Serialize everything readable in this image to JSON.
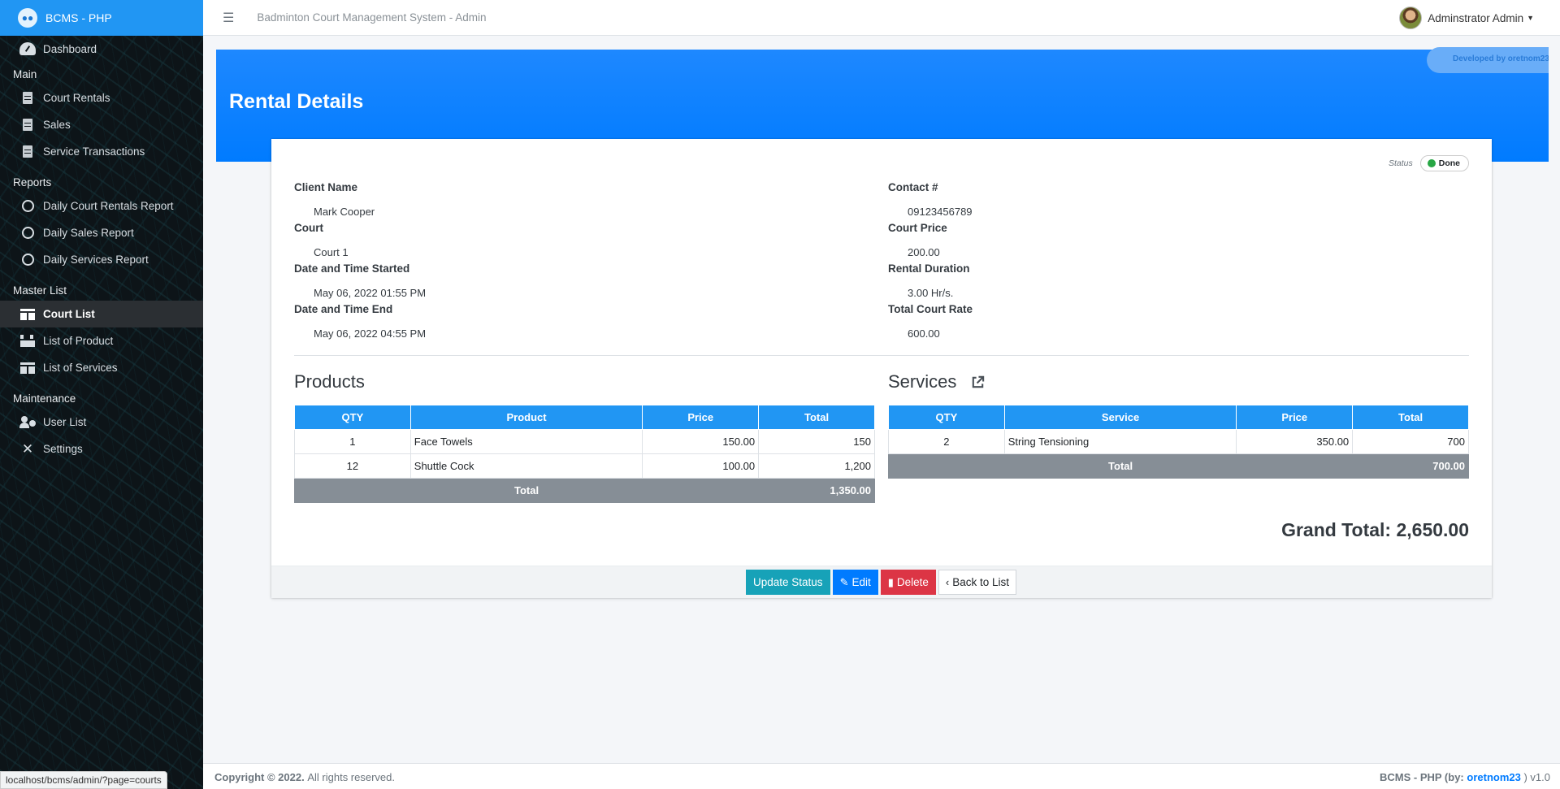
{
  "sidebar": {
    "brand": "BCMS - PHP",
    "dashboard": "Dashboard",
    "sections": {
      "main": "Main",
      "reports": "Reports",
      "master": "Master List",
      "maintenance": "Maintenance"
    },
    "main_items": [
      "Court Rentals",
      "Sales",
      "Service Transactions"
    ],
    "report_items": [
      "Daily Court Rentals Report",
      "Daily Sales Report",
      "Daily Services Report"
    ],
    "master_items": [
      "Court List",
      "List of Product",
      "List of Services"
    ],
    "maintenance_items": [
      "User List",
      "Settings"
    ],
    "active_item": "Court List"
  },
  "topbar": {
    "title": "Badminton Court Management System - Admin",
    "user": "Adminstrator Admin"
  },
  "status_url": "localhost/bcms/admin/?page=courts",
  "hero": {
    "title": "Rental Details",
    "dev_badge": "Developed by oretnom23"
  },
  "rental": {
    "status_label": "Status",
    "status_value": "Done",
    "status_color": "#28a745",
    "fields": {
      "client_name_label": "Client Name",
      "client_name": "Mark Cooper",
      "contact_label": "Contact #",
      "contact": "09123456789",
      "court_label": "Court",
      "court": "Court 1",
      "court_price_label": "Court Price",
      "court_price": "200.00",
      "started_label": "Date and Time Started",
      "started": "May 06, 2022 01:55 PM",
      "duration_label": "Rental Duration",
      "duration": "3.00 Hr/s.",
      "ended_label": "Date and Time End",
      "ended": "May 06, 2022 04:55 PM",
      "total_rate_label": "Total Court Rate",
      "total_rate": "600.00"
    }
  },
  "products": {
    "title": "Products",
    "headers": [
      "QTY",
      "Product",
      "Price",
      "Total"
    ],
    "rows": [
      {
        "qty": "1",
        "name": "Face Towels",
        "price": "150.00",
        "total": "150"
      },
      {
        "qty": "12",
        "name": "Shuttle Cock",
        "price": "100.00",
        "total": "1,200"
      }
    ],
    "total_label": "Total",
    "total": "1,350.00"
  },
  "services": {
    "title": "Services",
    "headers": [
      "QTY",
      "Service",
      "Price",
      "Total"
    ],
    "rows": [
      {
        "qty": "2",
        "name": "String Tensioning",
        "price": "350.00",
        "total": "700"
      }
    ],
    "total_label": "Total",
    "total": "700.00"
  },
  "grand_total": "Grand Total: 2,650.00",
  "actions": {
    "update_status": "Update Status",
    "edit": "Edit",
    "delete": "Delete",
    "back": "Back to List"
  },
  "footer": {
    "copyright": "Copyright © 2022.",
    "rights": "All rights reserved.",
    "version_prefix": "BCMS - PHP (by:",
    "author": "oretnom23",
    "version_suffix": ") v1.0"
  }
}
